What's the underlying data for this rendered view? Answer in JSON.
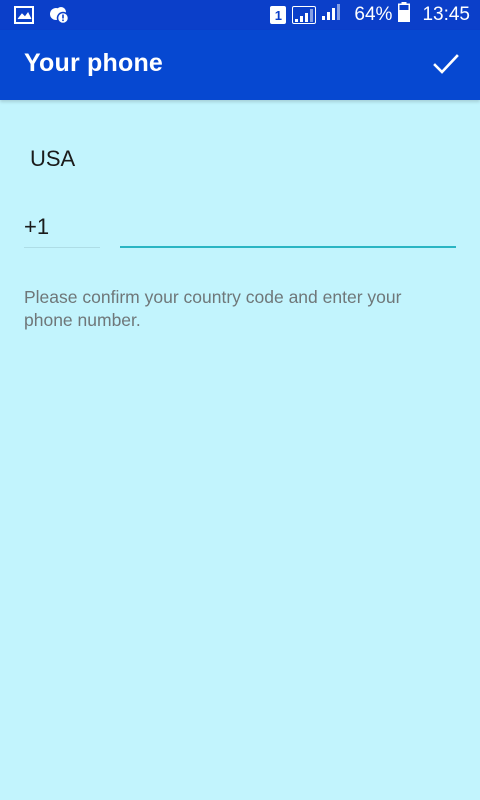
{
  "status_bar": {
    "sim_label": "1",
    "battery_percent": "64%",
    "time": "13:45",
    "icons": [
      "image-notification-icon",
      "alert-cloud-icon",
      "sim-card-icon",
      "signal-icon",
      "signal-icon",
      "battery-icon"
    ]
  },
  "app_bar": {
    "title": "Your phone",
    "confirm_icon": "checkmark-icon"
  },
  "form": {
    "country": "USA",
    "country_code": "+1",
    "phone_value": "",
    "phone_placeholder": "",
    "hint": "Please confirm your country code and enter your phone number."
  },
  "colors": {
    "status_bar_bg": "#0b3fc9",
    "app_bar_bg": "#0648d1",
    "page_bg": "#c2f4fd",
    "accent_underline": "#2ab5c3"
  }
}
